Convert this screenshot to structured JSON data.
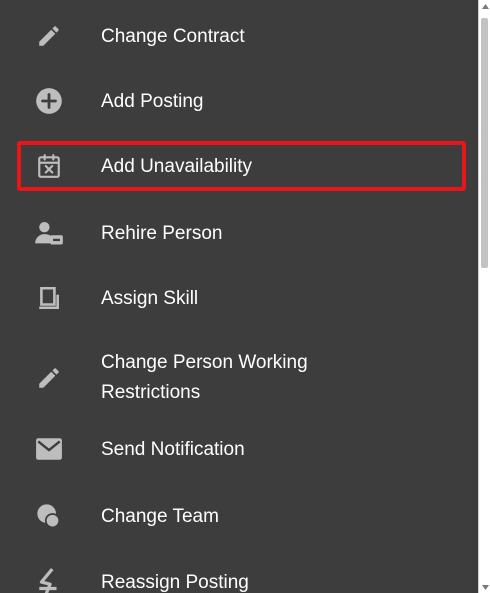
{
  "menu": {
    "items": [
      {
        "label": "Change Contract",
        "icon": "pencil-icon"
      },
      {
        "label": "Add Posting",
        "icon": "add-circle-icon"
      },
      {
        "label": "Add Unavailability",
        "icon": "calendar-x-icon",
        "highlighted": true
      },
      {
        "label": "Rehire Person",
        "icon": "person-minus-icon"
      },
      {
        "label": "Assign Skill",
        "icon": "skill-icon"
      },
      {
        "label": "Change Person Working Restrictions",
        "icon": "pencil-icon"
      },
      {
        "label": "Send Notification",
        "icon": "envelope-icon"
      },
      {
        "label": "Change Team",
        "icon": "team-icon"
      },
      {
        "label": "Reassign Posting",
        "icon": "reassign-icon"
      }
    ]
  },
  "colors": {
    "menu_background": "#3d3d3d",
    "text": "#ffffff",
    "icon": "#bdbdbd",
    "highlight_border": "#e8151b"
  }
}
